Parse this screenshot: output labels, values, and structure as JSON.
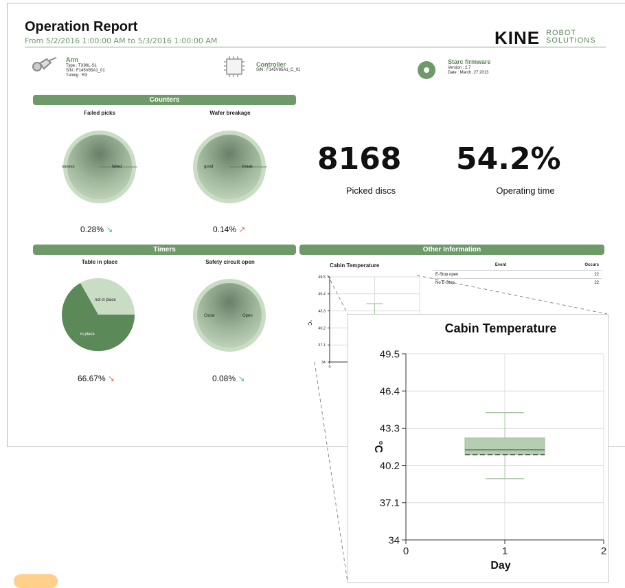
{
  "report": {
    "title": "Operation Report",
    "subtitle": "From 5/2/2016 1:00:00 AM to 5/3/2016 1:00:00 AM",
    "logo_main": "KINE",
    "logo_sub_1": "ROBOT",
    "logo_sub_2": "SOLUTIONS"
  },
  "devices": {
    "arm": {
      "title": "Arm",
      "lines": [
        "Type : TX90L-S1",
        "S/N : F145V85A1_01",
        "Tuning : R3"
      ],
      "icon": "robot-arm-icon"
    },
    "controller": {
      "title": "Controller",
      "lines": [
        "S/N : F145V85A1_C_01"
      ],
      "icon": "chip-icon"
    },
    "firmware": {
      "title": "Starc firmware",
      "lines": [
        "Version : 2.7",
        "Date : March, 27 2013"
      ],
      "icon": "disc-icon"
    }
  },
  "sections": {
    "counters": "Counters",
    "timers": "Timers",
    "other": "Other Information"
  },
  "counters": {
    "failed_picks": {
      "title": "Failed picks",
      "left_label": "sucess",
      "right_label": "failed",
      "percent": "0.28%",
      "trend": "↘"
    },
    "wafer_breakage": {
      "title": "Wafer breakage",
      "left_label": "good",
      "right_label": "break",
      "percent": "0.14%",
      "trend": "↗"
    }
  },
  "timers": {
    "table_in_place": {
      "title": "Table in place",
      "label_top": "not in place",
      "label_bottom": "in place",
      "percent": "66.67%",
      "trend": "↘"
    },
    "safety_circuit": {
      "title": "Safety circuit open",
      "left_label": "Close",
      "right_label": "Open",
      "percent": "0.08%",
      "trend": "↘"
    }
  },
  "metrics": {
    "picked_discs": {
      "value": "8168",
      "label": "Picked discs"
    },
    "operating_time": {
      "value": "54.2%",
      "label": "Operating time"
    }
  },
  "events": {
    "headers": [
      "Event",
      "Occurs"
    ],
    "rows": [
      [
        "E-Stop open",
        "22"
      ],
      [
        "No E-Stop",
        "22"
      ]
    ]
  },
  "colors": {
    "accent": "#6e9a6a",
    "gauge_light": "#c9dcc4",
    "gauge_dark": "#7a9676",
    "pie_dark": "#4e7f4c",
    "box_fill": "#b5cdb1"
  },
  "chart_data": [
    {
      "type": "pie",
      "title": "Failed picks",
      "labels": [
        "sucess",
        "failed"
      ],
      "values": [
        99.72,
        0.28
      ]
    },
    {
      "type": "pie",
      "title": "Wafer breakage",
      "labels": [
        "good",
        "break"
      ],
      "values": [
        99.86,
        0.14
      ]
    },
    {
      "type": "pie",
      "title": "Table in place",
      "labels": [
        "in place",
        "not in place"
      ],
      "values": [
        66.67,
        33.33
      ]
    },
    {
      "type": "pie",
      "title": "Safety circuit open",
      "labels": [
        "Close",
        "Open"
      ],
      "values": [
        99.92,
        0.08
      ]
    },
    {
      "type": "box",
      "title": "Cabin Temperature",
      "xlabel": "Day",
      "ylabel": "°C",
      "xlim": [
        0,
        2
      ],
      "ylim": [
        34,
        49.5
      ],
      "x_ticks": [
        "0",
        "1",
        "2"
      ],
      "y_ticks": [
        "49.5",
        "46.4",
        "43.3",
        "40.2",
        "37.1",
        "34"
      ],
      "boxes": [
        {
          "x": 1,
          "whisker_low": 39.1,
          "q1": 41.1,
          "median": 41.5,
          "mean": 41.1,
          "q3": 42.5,
          "whisker_high": 44.6
        }
      ]
    }
  ]
}
